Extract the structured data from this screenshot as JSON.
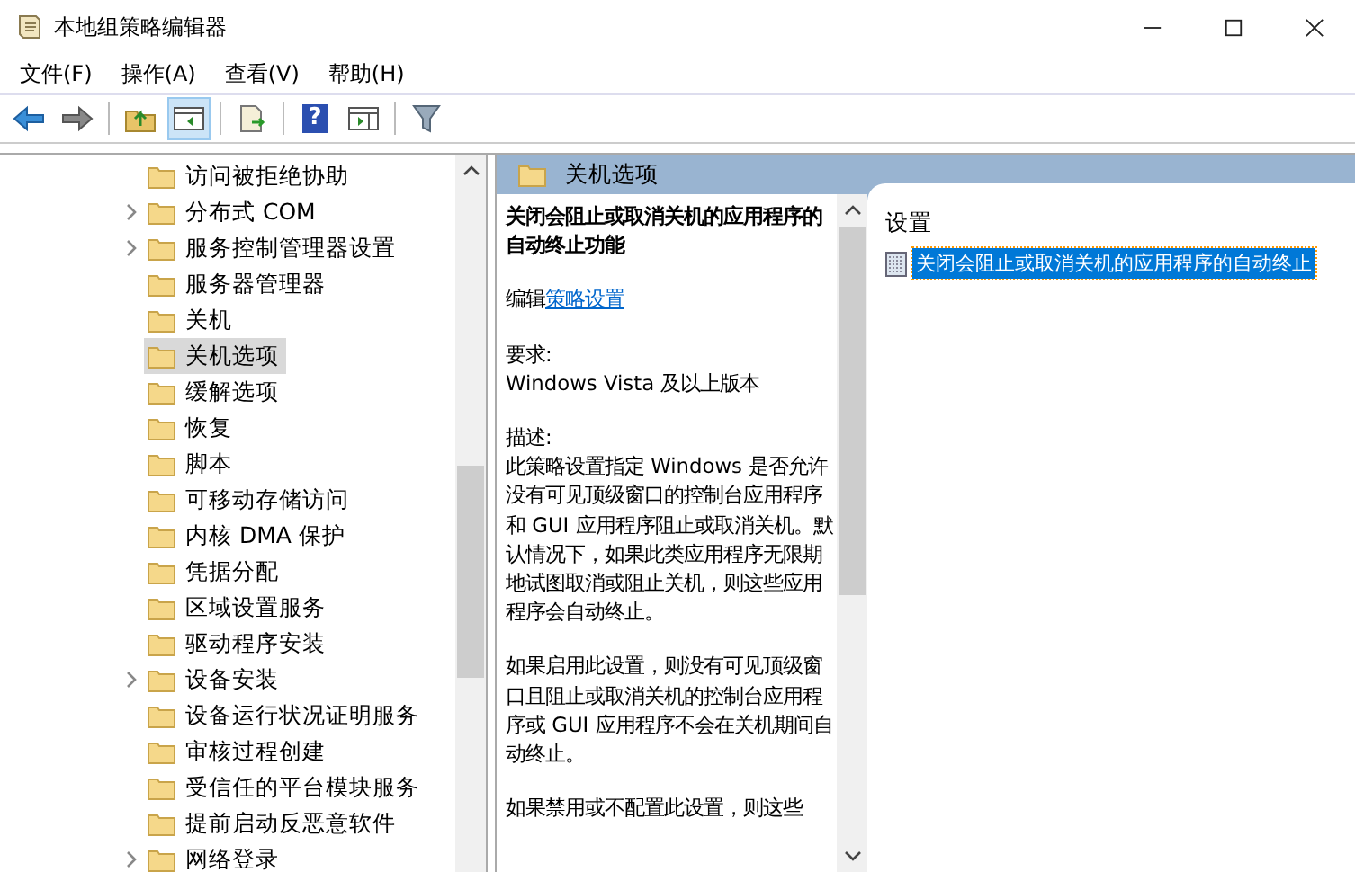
{
  "window": {
    "title": "本地组策略编辑器"
  },
  "menu": [
    "文件(F)",
    "操作(A)",
    "查看(V)",
    "帮助(H)"
  ],
  "toolbar": [
    {
      "kind": "back",
      "selected": false
    },
    {
      "kind": "forward",
      "selected": false
    },
    {
      "kind": "sep"
    },
    {
      "kind": "up",
      "selected": false
    },
    {
      "kind": "showhide",
      "selected": true
    },
    {
      "kind": "sep"
    },
    {
      "kind": "export",
      "selected": false
    },
    {
      "kind": "sep"
    },
    {
      "kind": "help",
      "selected": false,
      "glyph": "?"
    },
    {
      "kind": "pane",
      "selected": false
    },
    {
      "kind": "sep"
    },
    {
      "kind": "filter",
      "selected": false
    }
  ],
  "tree": [
    {
      "label": "访问被拒绝协助",
      "expandable": false,
      "selected": false
    },
    {
      "label": "分布式 COM",
      "expandable": true,
      "selected": false
    },
    {
      "label": "服务控制管理器设置",
      "expandable": true,
      "selected": false
    },
    {
      "label": "服务器管理器",
      "expandable": false,
      "selected": false
    },
    {
      "label": "关机",
      "expandable": false,
      "selected": false
    },
    {
      "label": "关机选项",
      "expandable": false,
      "selected": true
    },
    {
      "label": "缓解选项",
      "expandable": false,
      "selected": false
    },
    {
      "label": "恢复",
      "expandable": false,
      "selected": false
    },
    {
      "label": "脚本",
      "expandable": false,
      "selected": false
    },
    {
      "label": "可移动存储访问",
      "expandable": false,
      "selected": false
    },
    {
      "label": "内核 DMA 保护",
      "expandable": false,
      "selected": false
    },
    {
      "label": "凭据分配",
      "expandable": false,
      "selected": false
    },
    {
      "label": "区域设置服务",
      "expandable": false,
      "selected": false
    },
    {
      "label": "驱动程序安装",
      "expandable": false,
      "selected": false
    },
    {
      "label": "设备安装",
      "expandable": true,
      "selected": false
    },
    {
      "label": "设备运行状况证明服务",
      "expandable": false,
      "selected": false
    },
    {
      "label": "审核过程创建",
      "expandable": false,
      "selected": false
    },
    {
      "label": "受信任的平台模块服务",
      "expandable": false,
      "selected": false
    },
    {
      "label": "提前启动反恶意软件",
      "expandable": false,
      "selected": false
    },
    {
      "label": "网络登录",
      "expandable": true,
      "selected": false
    }
  ],
  "header": {
    "title": "关机选项"
  },
  "description": {
    "title": "关闭会阻止或取消关机的应用程序的自动终止功能",
    "edit_prefix": "编辑",
    "edit_link": "策略设置",
    "requirement_label": "要求:",
    "requirement": "Windows Vista 及以上版本",
    "desc_label": "描述:",
    "paragraphs": [
      "此策略设置指定 Windows 是否允许没有可见顶级窗口的控制台应用程序和 GUI 应用程序阻止或取消关机。默认情况下，如果此类应用程序无限期地试图取消或阻止关机，则这些应用程序会自动终止。",
      "如果启用此设置，则没有可见顶级窗口且阻止或取消关机的控制台应用程序或 GUI 应用程序不会在关机期间自动终止。",
      "如果禁用或不配置此设置，则这些"
    ]
  },
  "settings": {
    "column": "设置",
    "items": [
      {
        "label": "关闭会阻止或取消关机的应用程序的自动终止",
        "selected": true
      }
    ]
  }
}
